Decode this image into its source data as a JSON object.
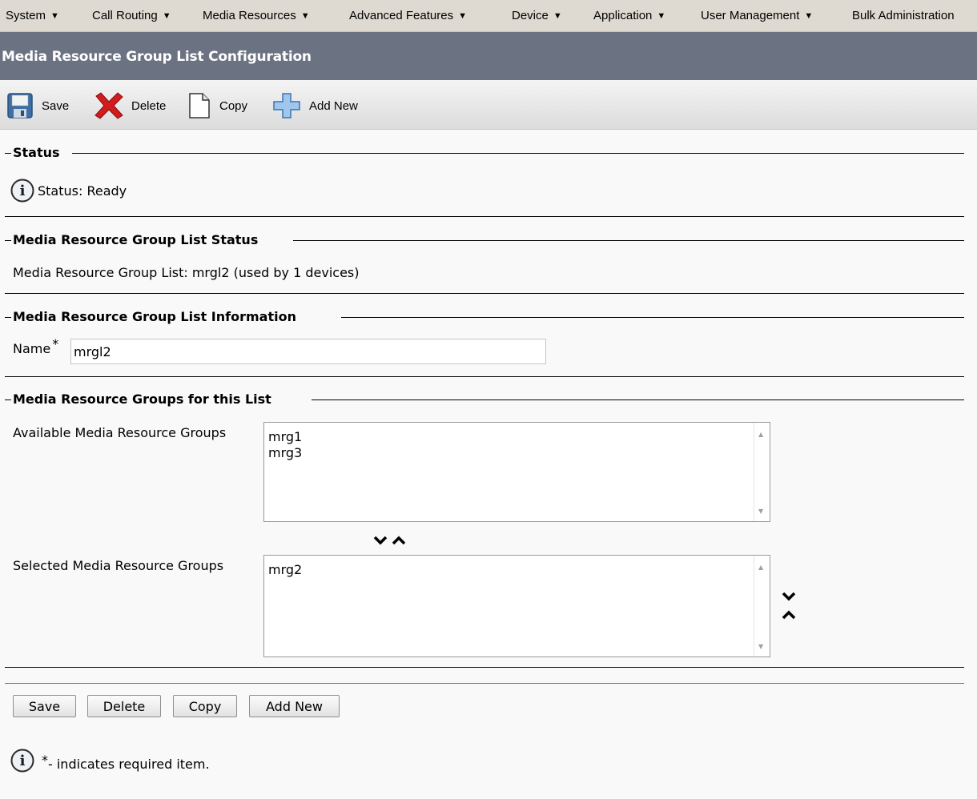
{
  "menu": {
    "items": [
      {
        "label": "System"
      },
      {
        "label": "Call Routing"
      },
      {
        "label": "Media Resources"
      },
      {
        "label": "Advanced Features"
      },
      {
        "label": "Device"
      },
      {
        "label": "Application"
      },
      {
        "label": "User Management"
      },
      {
        "label": "Bulk Administration"
      }
    ]
  },
  "page": {
    "title": "Media Resource Group List Configuration"
  },
  "toolbar": {
    "save_label": "Save",
    "delete_label": "Delete",
    "copy_label": "Copy",
    "add_new_label": "Add New"
  },
  "status_section": {
    "legend": "Status",
    "text": "Status: Ready"
  },
  "mrgl_status_section": {
    "legend": "Media Resource Group List Status",
    "text": "Media Resource Group List: mrgl2 (used by 1 devices)"
  },
  "info_section": {
    "legend": "Media Resource Group List Information",
    "name_label": "Name",
    "required_mark": "*",
    "name_value": "mrgl2"
  },
  "groups_section": {
    "legend": "Media Resource Groups for this List",
    "available_label": "Available Media Resource Groups",
    "available_items": [
      "mrg1",
      "mrg3"
    ],
    "selected_label": "Selected Media Resource Groups",
    "selected_items": [
      "mrg2"
    ]
  },
  "bottom_buttons": {
    "save_label": "Save",
    "delete_label": "Delete",
    "copy_label": "Copy",
    "add_new_label": "Add New"
  },
  "footer": {
    "required_mark": "*",
    "note": "- indicates required item."
  },
  "colors": {
    "menubar_bg": "#dedad1",
    "titlebar_bg": "#6b7382",
    "delete_red": "#d01c1c",
    "add_blue": "#4a8fd0"
  }
}
